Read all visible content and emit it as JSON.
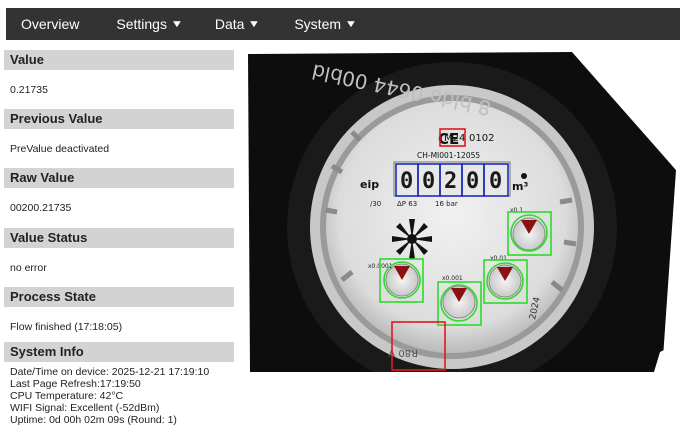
{
  "nav": {
    "overview": "Overview",
    "settings": "Settings",
    "data": "Data",
    "system": "System"
  },
  "panels": {
    "value": {
      "title": "Value",
      "text": "0.21735"
    },
    "previous": {
      "title": "Previous Value",
      "text": "PreValue deactivated"
    },
    "raw": {
      "title": "Raw Value",
      "text": "00200.21735"
    },
    "status": {
      "title": "Value Status",
      "text": "no error"
    },
    "process": {
      "title": "Process State",
      "text": "Flow finished (17:18:05)"
    },
    "sysinfo": {
      "title": "System Info",
      "lines": [
        "Date/Time on device: 2025-12-21 17:19:10",
        "Last Page Refresh:17:19:50",
        "CPU Temperature: 42°C",
        "WIFI Signal: Excellent (-52dBm)",
        "Uptime: 0d 00h 02m 09s (Round: 1)"
      ]
    }
  },
  "meter": {
    "ce_mark": "CE",
    "model_code": "M24",
    "model_suffix": "0102",
    "cert": "CH-MI001-12055",
    "digits": [
      "0",
      "0",
      "2",
      "0",
      "0"
    ],
    "unit": "m³",
    "brand": "eip",
    "spec_1": "/30",
    "spec_2": "ΔP 63",
    "spec_3": "16 bar",
    "dial_labels": [
      "x0.0001",
      "x0.001",
      "x0.01",
      "x0.1"
    ],
    "year": "2024",
    "edge_text": "R80 V",
    "rim_text": "8 bldo 0644 00bld"
  },
  "colors": {
    "topbar": "#333333",
    "panel_head": "#d3d3d3",
    "roi_digit": "#1f2fb5",
    "roi_analog": "#2bdc2b",
    "roi_align": "#e0181f"
  }
}
